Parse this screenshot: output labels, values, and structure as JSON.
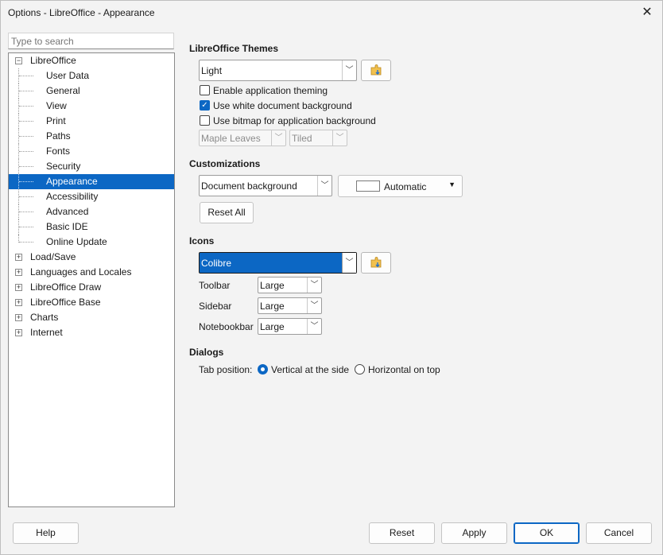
{
  "window": {
    "title": "Options - LibreOffice - Appearance"
  },
  "search": {
    "placeholder": "Type to search"
  },
  "tree": {
    "libreoffice": "LibreOffice",
    "children": [
      "User Data",
      "General",
      "View",
      "Print",
      "Paths",
      "Fonts",
      "Security",
      "Appearance",
      "Accessibility",
      "Advanced",
      "Basic IDE",
      "Online Update"
    ],
    "collapsed": [
      "Load/Save",
      "Languages and Locales",
      "LibreOffice Draw",
      "LibreOffice Base",
      "Charts",
      "Internet"
    ],
    "selected": "Appearance"
  },
  "themes": {
    "title": "LibreOffice Themes",
    "theme_value": "Light",
    "enable_app_theming": "Enable application theming",
    "use_white_doc_bg": "Use white document background",
    "use_bitmap_bg": "Use bitmap for application background",
    "bitmap_value": "Maple Leaves",
    "bitmap_mode": "Tiled"
  },
  "customizations": {
    "title": "Customizations",
    "item_value": "Document background",
    "color_label": "Automatic",
    "reset_all": "Reset All"
  },
  "icons": {
    "title": "Icons",
    "theme_value": "Colibre",
    "toolbar_label": "Toolbar",
    "toolbar_value": "Large",
    "sidebar_label": "Sidebar",
    "sidebar_value": "Large",
    "notebookbar_label": "Notebookbar",
    "notebookbar_value": "Large"
  },
  "dialogs": {
    "title": "Dialogs",
    "tab_position_label": "Tab position:",
    "vertical": "Vertical at the side",
    "horizontal": "Horizontal on top"
  },
  "footer": {
    "help": "Help",
    "reset": "Reset",
    "apply": "Apply",
    "ok": "OK",
    "cancel": "Cancel"
  },
  "colors": {
    "selection": "#0c67c4",
    "window_bg": "#f3f3f3"
  }
}
